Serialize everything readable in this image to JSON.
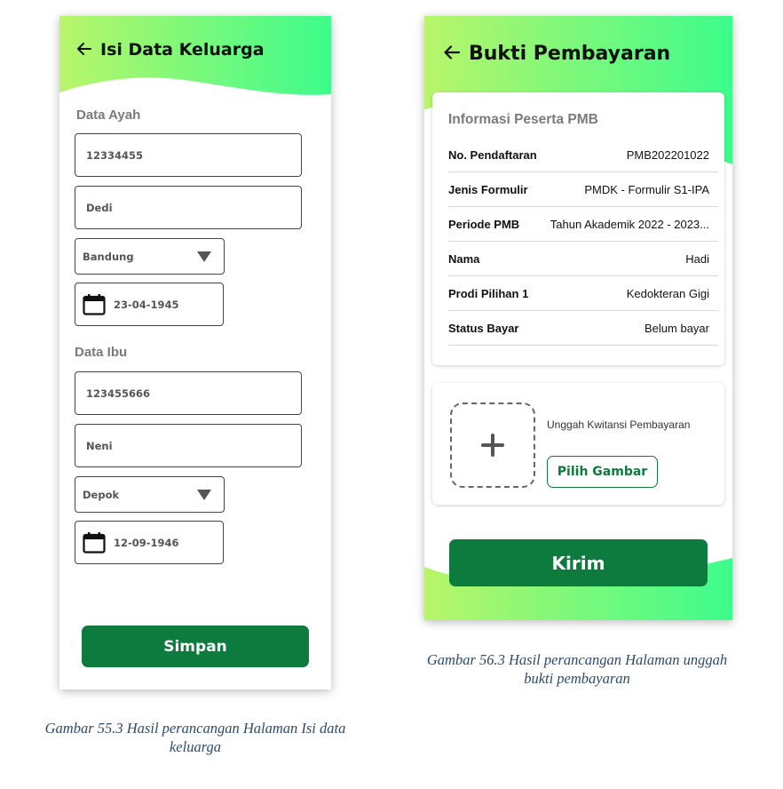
{
  "screen1": {
    "title": "Isi Data Keluarga",
    "father_section": "Data Ayah",
    "father_id": "12334455",
    "father_name": "Dedi",
    "father_city": "Bandung",
    "father_dob": "23-04-1945",
    "mother_section": "Data Ibu",
    "mother_id": "123455666",
    "mother_name": "Neni",
    "mother_city": "Depok",
    "mother_dob": "12-09-1946",
    "save_label": "Simpan"
  },
  "screen2": {
    "title": "Bukti Pembayaran",
    "info_title": "Informasi Peserta PMB",
    "rows": [
      {
        "label": "No. Pendaftaran",
        "value": "PMB202201022"
      },
      {
        "label": "Jenis Formulir",
        "value": "PMDK - Formulir S1-IPA"
      },
      {
        "label": "Periode PMB",
        "value": "Tahun Akademik 2022 - 2023..."
      },
      {
        "label": "Nama",
        "value": "Hadi"
      },
      {
        "label": "Prodi Pilihan 1",
        "value": "Kedokteran Gigi"
      },
      {
        "label": "Status Bayar",
        "value": "Belum bayar"
      }
    ],
    "upload_label": "Unggah Kwitansi Pembayaran",
    "pick_label": "Pilih Gambar",
    "send_label": "Kirim"
  },
  "captions": {
    "fig1_line1": "Gambar 55.3 Hasil perancangan Halaman Isi data",
    "fig1_line2": "keluarga",
    "fig2_line1": "Gambar 56.3 Hasil perancangan Halaman unggah",
    "fig2_line2": "bukti pembayaran"
  },
  "colors": {
    "primary_green": "#0d7a3e",
    "gradient_start": "#b8f56a",
    "gradient_end": "#3dfc8c"
  },
  "icons": [
    "back-arrow-icon",
    "dropdown-triangle-icon",
    "calendar-icon",
    "plus-icon"
  ]
}
